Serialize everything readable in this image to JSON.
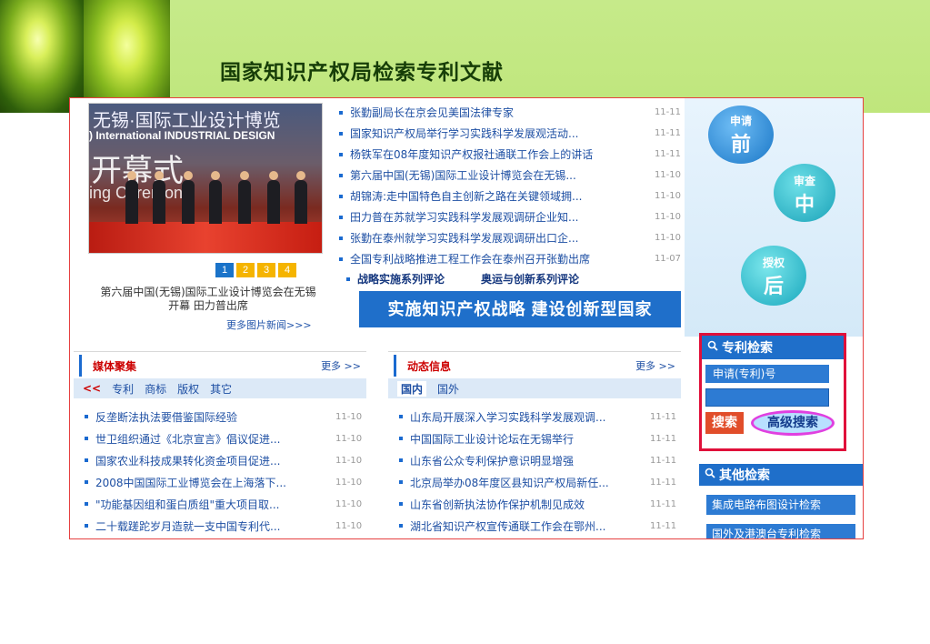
{
  "page": {
    "title": "国家知识产权局检索专利文献"
  },
  "photo": {
    "overlay_line1": "无锡·国际工业设计博览",
    "overlay_line2": ") International INDUSTRIAL DESIGN",
    "overlay_line3": "开幕式",
    "overlay_line4": "ing Ceremony",
    "pages": [
      "1",
      "2",
      "3",
      "4"
    ],
    "active_page": "1",
    "caption": "第六届中国(无锡)国际工业设计博览会在无锡开幕 田力普出席",
    "more": "更多图片新闻>>>"
  },
  "news": [
    {
      "title": "张勤副局长在京会见美国法律专家",
      "date": "11-11"
    },
    {
      "title": "国家知识产权局举行学习实践科学发展观活动...",
      "date": "11-11"
    },
    {
      "title": "杨铁军在08年度知识产权报社通联工作会上的讲话",
      "date": "11-11"
    },
    {
      "title": "第六届中国(无锡)国际工业设计博览会在无锡...",
      "date": "11-10"
    },
    {
      "title": "胡锦涛:走中国特色自主创新之路在关键领域拥...",
      "date": "11-10"
    },
    {
      "title": "田力普在苏就学习实践科学发展观调研企业知...",
      "date": "11-10"
    },
    {
      "title": "张勤在泰州就学习实践科学发展观调研出口企...",
      "date": "11-10"
    },
    {
      "title": "全国专利战略推进工程工作会在泰州召开张勤出席",
      "date": "11-07"
    }
  ],
  "features": [
    "战略实施系列评论",
    "奥运与创新系列评论"
  ],
  "slogan": "实施知识产权战略  建设创新型国家",
  "stages": [
    {
      "small": "申请",
      "big": "前"
    },
    {
      "small": "审查",
      "big": "中"
    },
    {
      "small": "授权",
      "big": "后"
    }
  ],
  "media": {
    "title": "媒体聚集",
    "more": "更多 >>",
    "tabs": [
      "<<",
      "专利",
      "商标",
      "版权",
      "其它"
    ],
    "items": [
      {
        "title": "反垄断法执法要借鉴国际经验",
        "date": "11-10"
      },
      {
        "title": "世卫组织通过《北京宣言》倡议促进...",
        "date": "11-10"
      },
      {
        "title": "国家农业科技成果转化资金项目促进...",
        "date": "11-10"
      },
      {
        "title": "2008中国国际工业博览会在上海落下...",
        "date": "11-10"
      },
      {
        "title": "\"功能基因组和蛋白质组\"重大项目取...",
        "date": "11-10"
      },
      {
        "title": "二十载蹉跎岁月造就一支中国专利代...",
        "date": "11-10"
      }
    ]
  },
  "dynamic": {
    "title": "动态信息",
    "more": "更多 >>",
    "tabs": [
      "国内",
      "国外"
    ],
    "items": [
      {
        "title": "山东局开展深入学习实践科学发展观调...",
        "date": "11-11"
      },
      {
        "title": "中国国际工业设计论坛在无锡举行",
        "date": "11-11"
      },
      {
        "title": "山东省公众专利保护意识明显增强",
        "date": "11-11"
      },
      {
        "title": "北京局举办08年度区县知识产权局新任...",
        "date": "11-11"
      },
      {
        "title": "山东省创新执法协作保护机制见成效",
        "date": "11-11"
      },
      {
        "title": "湖北省知识产权宣传通联工作会在鄂州...",
        "date": "11-11"
      }
    ]
  },
  "search": {
    "title": "专利检索",
    "field_label": "申请(专利)号",
    "search_btn": "搜索",
    "advanced_btn": "高级搜索"
  },
  "other": {
    "title": "其他检索",
    "links": [
      "集成电路布图设计检索",
      "国外及港澳台专利检索"
    ]
  }
}
